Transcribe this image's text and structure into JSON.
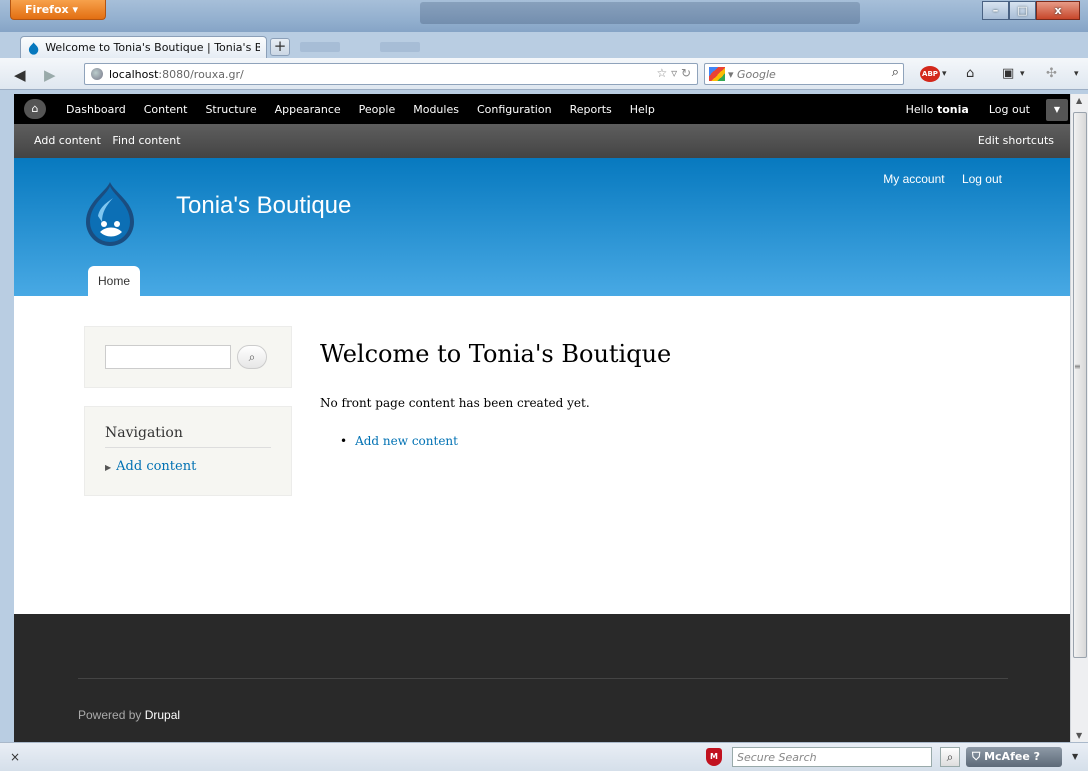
{
  "browser": {
    "app_button": "Firefox ▾",
    "tab_title": "Welcome to Tonia's Boutique | Tonia's B...",
    "new_tab": "+",
    "url_host": "localhost",
    "url_path": ":8080/rouxa.gr/",
    "search_placeholder": "Google",
    "window_min": "–",
    "window_max": "□",
    "window_close": "x"
  },
  "toolbar": {
    "menu": [
      "Dashboard",
      "Content",
      "Structure",
      "Appearance",
      "People",
      "Modules",
      "Configuration",
      "Reports",
      "Help"
    ],
    "hello": "Hello",
    "username": "tonia",
    "logout": "Log out"
  },
  "shortcuts": {
    "items": [
      "Add content",
      "Find content"
    ],
    "edit": "Edit shortcuts"
  },
  "site": {
    "name": "Tonia's Boutique",
    "secondary_menu": [
      "My account",
      "Log out"
    ],
    "main_tab": "Home"
  },
  "sidebar": {
    "navigation_title": "Navigation",
    "navigation_items": [
      "Add content"
    ]
  },
  "content": {
    "title": "Welcome to Tonia's Boutique",
    "text": "No front page content has been created yet.",
    "links": [
      "Add new content"
    ]
  },
  "footer": {
    "powered_by": "Powered by",
    "drupal": "Drupal"
  },
  "addonbar": {
    "close": "×",
    "secure_search_placeholder": "Secure Search",
    "mcafee": "McAfee"
  },
  "colors": {
    "header_top": "#0779bf",
    "header_bottom": "#48a9e4",
    "link": "#0071b3",
    "footer": "#292929",
    "toolbar": "#000000"
  }
}
